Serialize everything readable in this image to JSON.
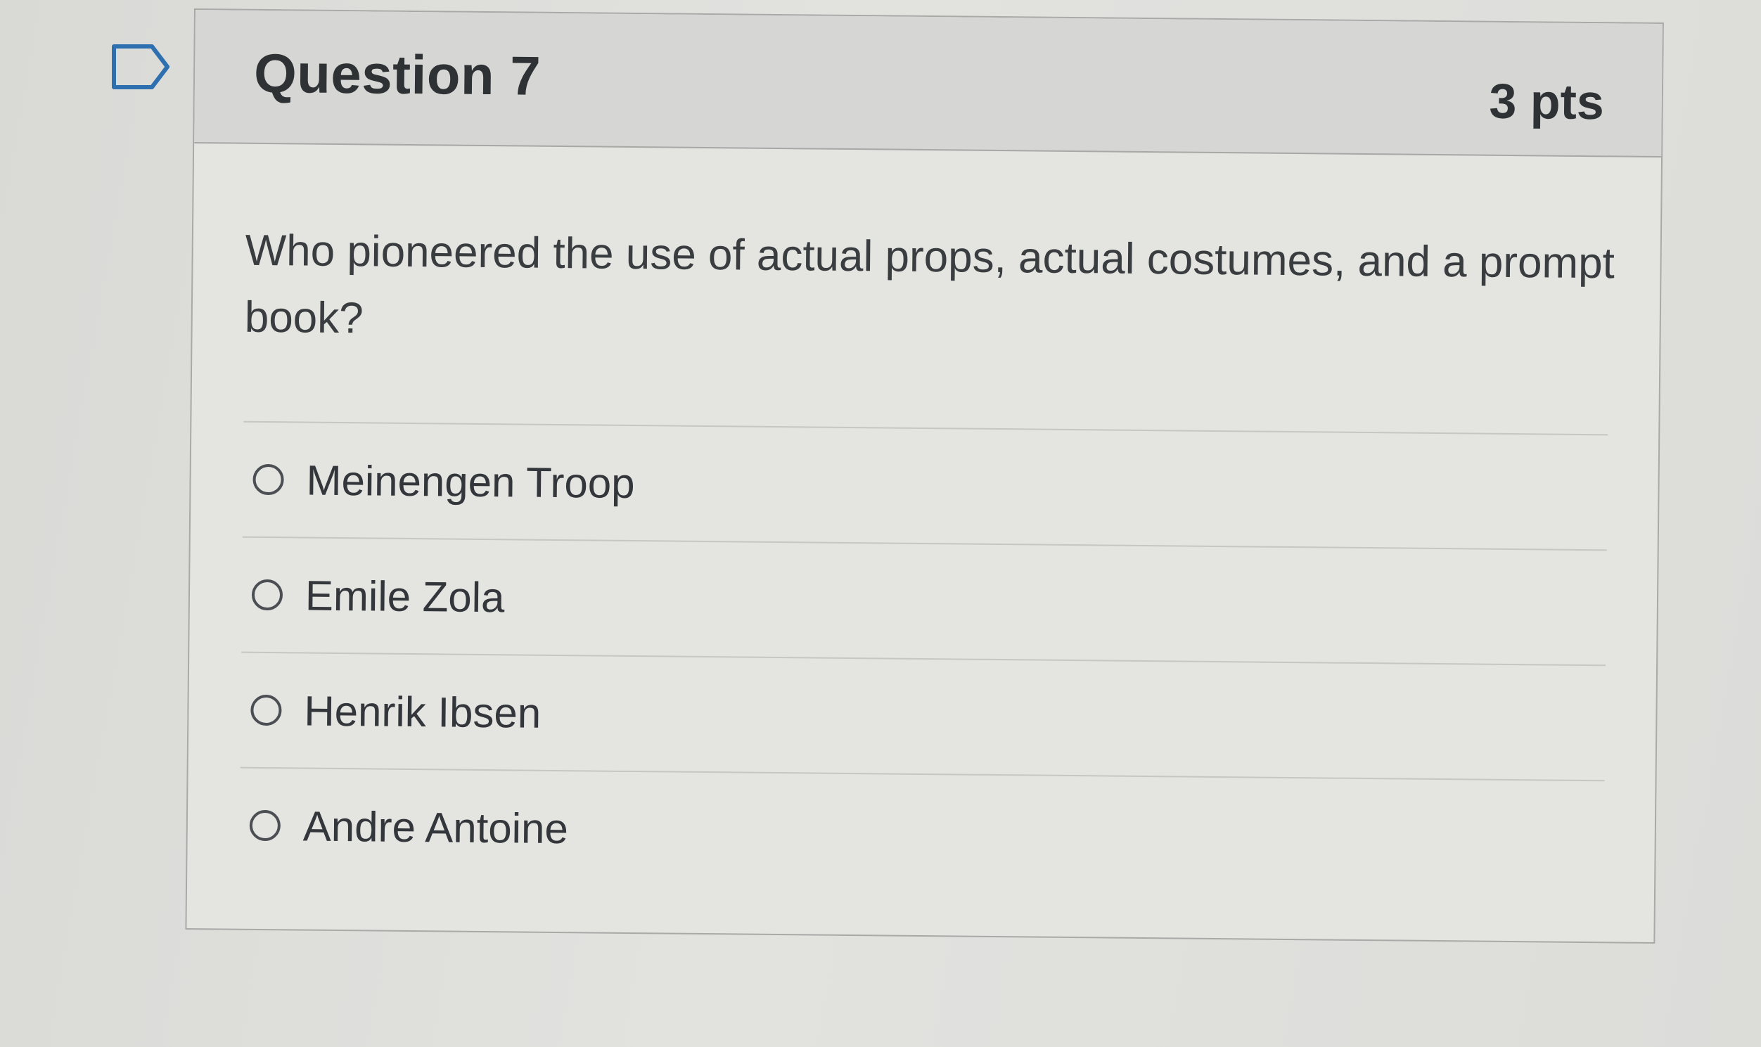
{
  "question": {
    "title": "Question 7",
    "points": "3 pts",
    "text": "Who pioneered the use of actual props, actual costumes, and a prompt book?",
    "flag_icon": "flag-question-icon",
    "answers": [
      {
        "label": "Meinengen Troop",
        "selected": false
      },
      {
        "label": "Emile Zola",
        "selected": false
      },
      {
        "label": "Henrik Ibsen",
        "selected": false
      },
      {
        "label": "Andre Antoine",
        "selected": false
      }
    ]
  },
  "colors": {
    "background": "#e0e0dd",
    "header": "#d6d7d4",
    "card": "#e4e4e1",
    "flag_stroke": "#2e6fb0",
    "text": "#2f3235"
  }
}
